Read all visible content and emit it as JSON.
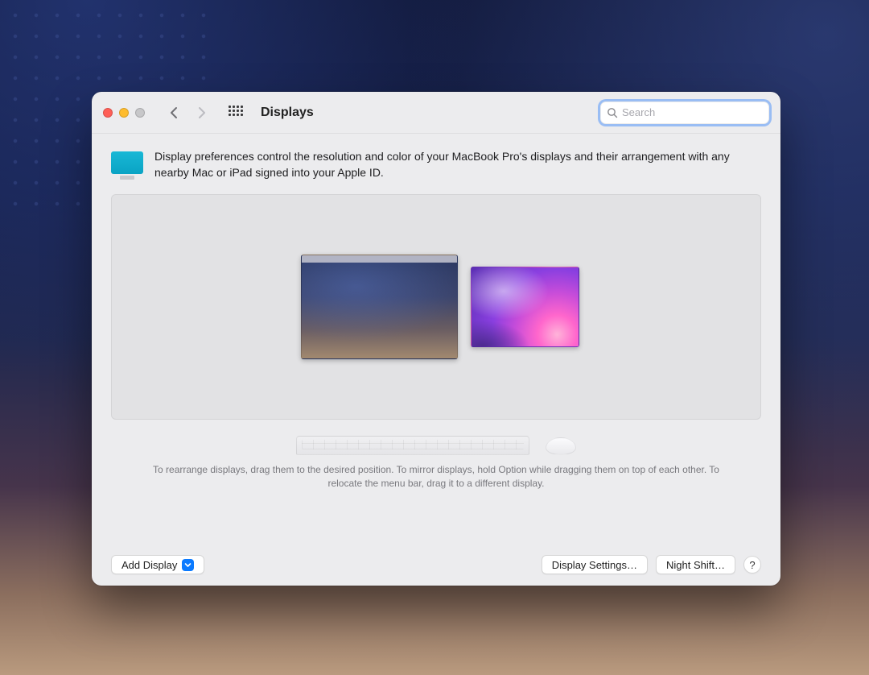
{
  "window": {
    "title": "Displays",
    "search_placeholder": "Search",
    "search_value": ""
  },
  "intro": {
    "text": "Display preferences control the resolution and color of your MacBook Pro's displays and their arrangement with any nearby Mac or iPad signed into your Apple ID."
  },
  "hint": {
    "text": "To rearrange displays, drag them to the desired position. To mirror displays, hold Option while dragging them on top of each other. To relocate the menu bar, drag it to a different display."
  },
  "buttons": {
    "add_display": "Add Display",
    "display_settings": "Display Settings…",
    "night_shift": "Night Shift…",
    "help": "?"
  },
  "displays": [
    {
      "id": "primary",
      "has_menu_bar": true
    },
    {
      "id": "secondary",
      "has_menu_bar": false
    }
  ]
}
